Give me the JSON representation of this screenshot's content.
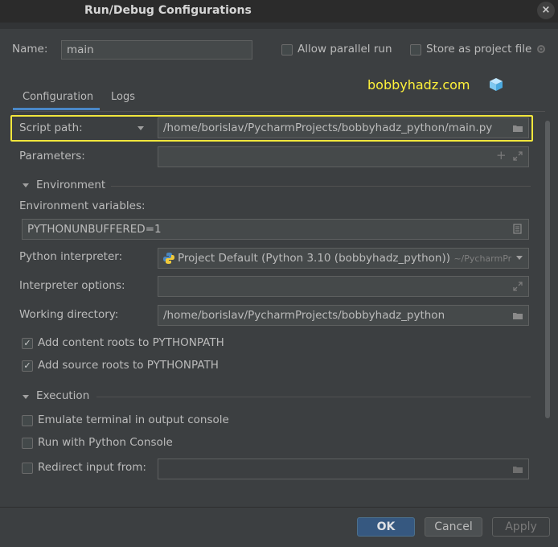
{
  "window": {
    "title": "Run/Debug Configurations",
    "close_glyph": "×"
  },
  "header": {
    "name_label": "Name:",
    "name_value": "main",
    "allow_parallel_label": "Allow parallel run",
    "store_project_label": "Store as project file"
  },
  "tabs": [
    {
      "label": "Configuration",
      "active": true
    },
    {
      "label": "Logs",
      "active": false
    }
  ],
  "watermark": "bobbyhadz.com",
  "config": {
    "script_path_label": "Script path:",
    "script_path_value": "/home/borislav/PycharmProjects/bobbyhadz_python/main.py",
    "parameters_label": "Parameters:",
    "environment_section": "Environment",
    "env_vars_label": "Environment variables:",
    "env_vars_value": "PYTHONUNBUFFERED=1",
    "interpreter_label": "Python interpreter:",
    "interpreter_value": "Project Default (Python 3.10 (bobbyhadz_python))",
    "interpreter_path_hint": "~/PycharmPr",
    "interpreter_options_label": "Interpreter options:",
    "working_dir_label": "Working directory:",
    "working_dir_value": "/home/borislav/PycharmProjects/bobbyhadz_python",
    "content_roots_label": "Add content roots to PYTHONPATH",
    "content_roots_checked": true,
    "source_roots_label": "Add source roots to PYTHONPATH",
    "source_roots_checked": true,
    "execution_section": "Execution",
    "emulate_terminal_label": "Emulate terminal in output console",
    "run_console_label": "Run with Python Console",
    "redirect_input_label": "Redirect input from:"
  },
  "footer": {
    "ok_label": "OK",
    "cancel_label": "Cancel",
    "apply_label": "Apply"
  },
  "colors": {
    "highlight": "#f2e73c",
    "accent": "#365880",
    "background": "#3c3f41"
  }
}
